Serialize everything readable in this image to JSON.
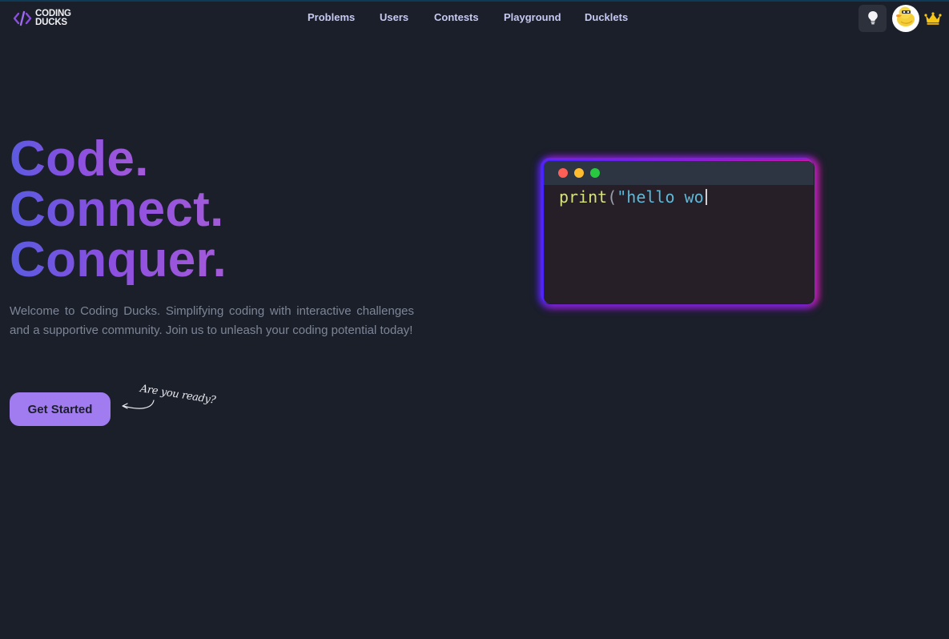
{
  "brand": {
    "logo_line1": "CODING",
    "logo_line2": "DUCKS",
    "accent": "#8b4fe0"
  },
  "nav": {
    "items": [
      {
        "label": "Problems"
      },
      {
        "label": "Users"
      },
      {
        "label": "Contests"
      },
      {
        "label": "Playground"
      },
      {
        "label": "Ducklets"
      }
    ]
  },
  "header_actions": {
    "theme_icon": "lightbulb-icon",
    "avatar_icon": "duck-avatar",
    "crown_icon": "crown-icon"
  },
  "hero": {
    "line1": "Code.",
    "line2": "Connect.",
    "line3": "Conquer.",
    "description": "Welcome to Coding Ducks. Simplifying coding with interactive challenges and a supportive community. Join us to unleash your coding potential today!",
    "cta_label": "Get Started",
    "handwritten_note": "Are you ready?"
  },
  "editor": {
    "code_fn": "print",
    "code_paren": "(",
    "code_string": "\"hello wo",
    "window_dots": [
      "#ff5f57",
      "#febc2e",
      "#28c840"
    ]
  }
}
